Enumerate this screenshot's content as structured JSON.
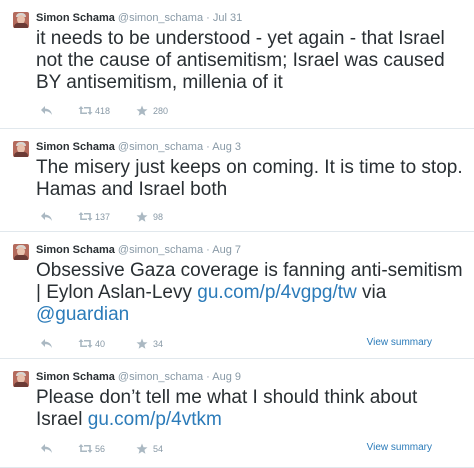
{
  "tweets": [
    {
      "name": "Simon Schama",
      "handle": "@simon_schama",
      "separator": "·",
      "time": "Jul 31",
      "text": "it needs to be understood - yet again - that Israel not the cause of antisemitism; Israel was caused BY antisemitism, millenia of it",
      "link_text": "",
      "suffix_text": "",
      "retweets": "418",
      "favorites": "280",
      "summary_label": ""
    },
    {
      "name": "Simon Schama",
      "handle": "@simon_schama",
      "separator": "·",
      "time": "Aug 3",
      "text": "The misery just keeps on coming. It is time to stop. Hamas and Israel both",
      "link_text": "",
      "suffix_text": "",
      "retweets": "137",
      "favorites": "98",
      "summary_label": ""
    },
    {
      "name": "Simon Schama",
      "handle": "@simon_schama",
      "separator": "·",
      "time": "Aug 7",
      "text": "Obsessive Gaza coverage is fanning anti-semitism | Eylon Aslan-Levy ",
      "link_text": "gu.com/p/4vgpg/tw",
      "suffix_text": " via ",
      "mention_text": "@guardian",
      "retweets": "40",
      "favorites": "34",
      "summary_label": "View summary"
    },
    {
      "name": "Simon Schama",
      "handle": "@simon_schama",
      "separator": "·",
      "time": "Aug 9",
      "text": "Please don’t tell me what I should think about Israel ",
      "link_text": "gu.com/p/4vtkm",
      "suffix_text": "",
      "retweets": "56",
      "favorites": "54",
      "summary_label": "View summary"
    }
  ],
  "icons": {
    "reply": "reply-arrow-icon",
    "retweet": "retweet-icon",
    "favorite": "star-icon"
  },
  "colors": {
    "link": "#2b7bb9",
    "meta": "#8899a6",
    "text": "#292f33"
  }
}
